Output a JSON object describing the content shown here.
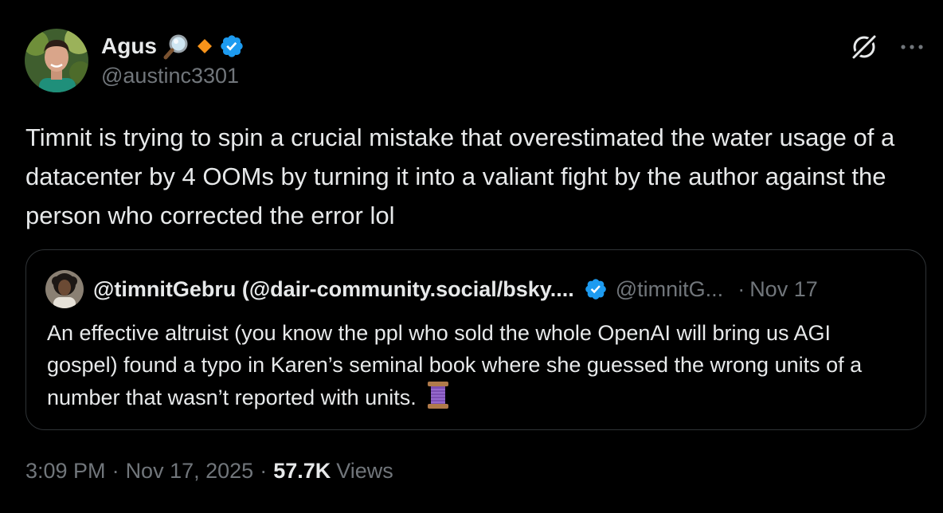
{
  "author": {
    "display_name": "Agus",
    "handle": "@austinc3301",
    "badges": [
      "magnifying-glass-icon",
      "orange-diamond-icon",
      "verified-badge-icon"
    ],
    "verified_color": "#1d9bf0"
  },
  "header_actions": [
    "grok-icon",
    "more-icon"
  ],
  "tweet": {
    "text": "Timnit is trying to spin a crucial mistake that overestimated the water usage of a datacenter by 4 OOMs by turning it into a valiant fight by the author against the person who corrected the error lol"
  },
  "quoted_tweet": {
    "display_name": "@timnitGebru (@dair-community.social/bsky....",
    "handle": "@timnitG...",
    "dot": "·",
    "date": "Nov 17",
    "text": "An effective altruist (you know the ppl who sold the whole OpenAI will bring us AGI gospel) found a typo in Karen’s seminal book where she guessed the wrong units of a number that wasn’t reported with units.",
    "emoji": "thread-spool-icon"
  },
  "meta": {
    "time": "3:09 PM",
    "sep1": "·",
    "date": "Nov 17, 2025",
    "sep2": "·",
    "views_count": "57.7K",
    "views_label": "Views"
  },
  "colors": {
    "background": "#000000",
    "text_primary": "#e7e9ea",
    "text_secondary": "#71767b",
    "border": "#2f3336",
    "verified": "#1d9bf0",
    "diamond": "#f7931a"
  }
}
